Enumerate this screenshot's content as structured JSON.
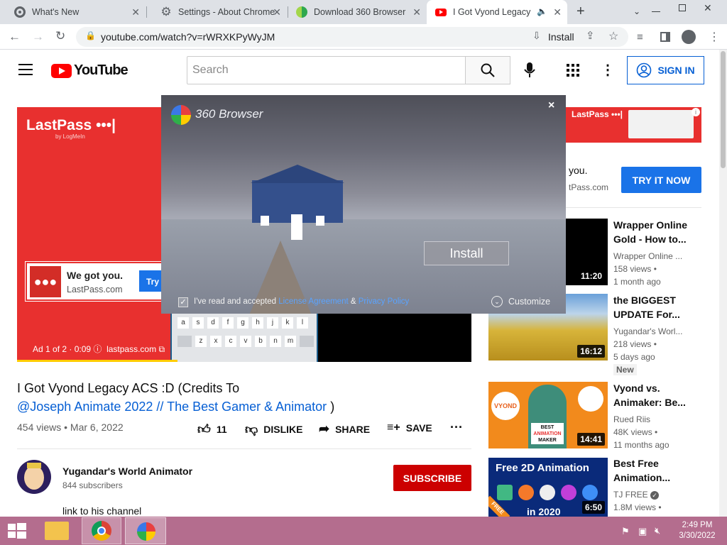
{
  "browser": {
    "tabs": [
      {
        "title": "What's New"
      },
      {
        "title": "Settings - About Chrome"
      },
      {
        "title": "Download 360 Browser fo"
      },
      {
        "title": "I Got Vyond Legacy ACS"
      }
    ],
    "url": "youtube.com/watch?v=rWRXKPyWyJM",
    "install_label": "Install"
  },
  "youtube": {
    "logo_text": "YouTube",
    "search_placeholder": "Search",
    "sign_in": "SIGN IN",
    "ad": {
      "brand": "LastPass",
      "byline": "by LogMeIn",
      "box_title": "We got you.",
      "box_sub": "LastPass.com",
      "box_btn": "Try",
      "ad_info": "Ad 1 of 2 · 0:09",
      "ad_domain": "lastpass.com",
      "keyboard_row1": [
        "a",
        "s",
        "d",
        "f",
        "g",
        "h",
        "j",
        "k",
        "l"
      ],
      "keyboard_row2": [
        "z",
        "x",
        "c",
        "v",
        "b",
        "n",
        "m"
      ]
    },
    "side_ad": {
      "brand": "LastPass",
      "text1": "you.",
      "text2": "tPass.com",
      "cta": "TRY IT NOW"
    },
    "video": {
      "title_line1": "I Got Vyond Legacy ACS :D (Credits To",
      "title_link": "@Joseph Animate 2022 // The Best Gamer & Animator",
      "title_end": ")",
      "meta": "454 views • Mar 6, 2022",
      "likes": "11",
      "dislike": "DISLIKE",
      "share": "SHARE",
      "save": "SAVE"
    },
    "channel": {
      "name": "Yugandar's World Animator",
      "subs": "844 subscribers",
      "subscribe": "SUBSCRIBE",
      "desc": "link to his channel"
    },
    "related": [
      {
        "title": "Wrapper Online Gold - How to...",
        "channel": "Wrapper Online ...",
        "views": "158 views •",
        "age": "1 month ago",
        "duration": "11:20"
      },
      {
        "title": "the BIGGEST UPDATE For...",
        "channel": "Yugandar's Worl...",
        "views": "218 views •",
        "age": "5 days ago",
        "badge": "New",
        "duration": "16:12"
      },
      {
        "title": "Vyond vs. Animaker: Be...",
        "channel": "Rued Riis",
        "views": "48K views •",
        "age": "11 months ago",
        "duration": "14:41",
        "thumb_text1": "BEST",
        "thumb_text2": "ANIMATION",
        "thumb_text3": "MAKER",
        "thumb_brand": "VYOND"
      },
      {
        "title": "Best Free Animation...",
        "channel": "TJ FREE",
        "views": "1.8M views •",
        "age": "",
        "duration": "6:50",
        "thumb_text1": "Free 2D Animation",
        "thumb_text2": "in 2020",
        "thumb_ribbon": "FREE"
      }
    ]
  },
  "dialog": {
    "brand": "360 Browser",
    "close": "×",
    "install": "Install",
    "agree_prefix": "I've read and accepted",
    "license": "License Agreement",
    "amp": "&",
    "privacy": "Privacy Policy",
    "customize": "Customize"
  },
  "taskbar": {
    "time": "2:49 PM",
    "date": "3/30/2022"
  }
}
